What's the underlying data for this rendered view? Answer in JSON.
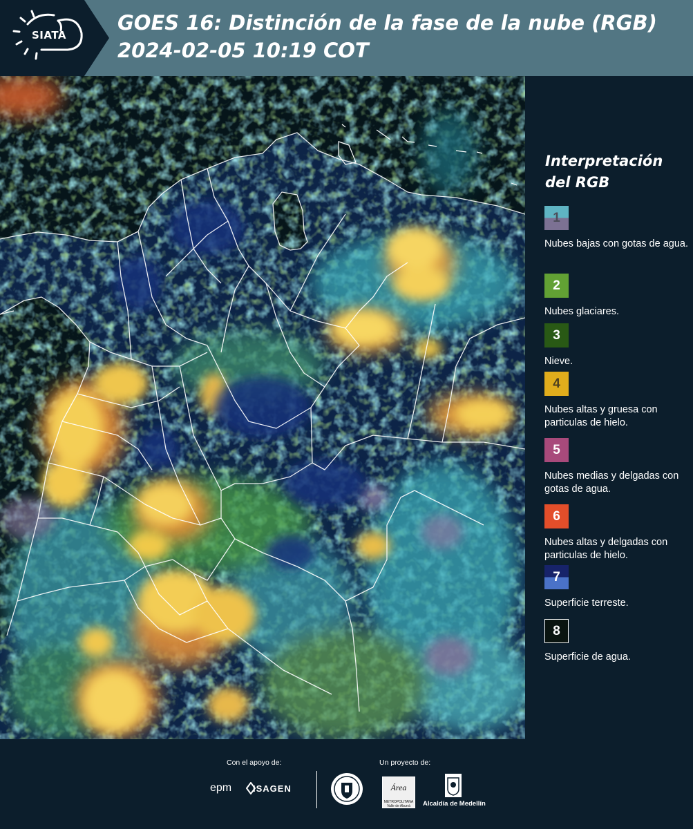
{
  "header": {
    "logo_text": "SIATA",
    "title_line1": "GOES 16: Distinción de la fase de la nube (RGB)",
    "title_line2": "2024-02-05 10:19 COT"
  },
  "legend": {
    "title_line1": "Interpretación",
    "title_line2": "del RGB",
    "items": [
      {
        "num": "1",
        "label": "Nubes bajas con gotas de agua.",
        "color_top": "#5fb4c3",
        "color_bottom": "#7c7193",
        "text_color": "#4d4d5a"
      },
      {
        "num": "2",
        "label": "Nubes glaciares.",
        "color_top": "#62a134",
        "color_bottom": "#62a134",
        "text_color": "#ffffff"
      },
      {
        "num": "3",
        "label": "Nieve.",
        "color_top": "#295915",
        "color_bottom": "#295915",
        "text_color": "#ffffff"
      },
      {
        "num": "4",
        "label": "Nubes altas y gruesa con particulas de hielo.",
        "color_top": "#e1ad1c",
        "color_bottom": "#e1ad1c",
        "text_color": "#4d4020"
      },
      {
        "num": "5",
        "label": "Nubes medias y delgadas con gotas de agua.",
        "color_top": "#a84a7b",
        "color_bottom": "#a84a7b",
        "text_color": "#ffffff"
      },
      {
        "num": "6",
        "label": "Nubes altas y delgadas con particulas de hielo.",
        "color_top": "#e34e2a",
        "color_bottom": "#e34e2a",
        "text_color": "#ffffff"
      },
      {
        "num": "7",
        "label": "Superficie terreste.",
        "color_top": "#17236a",
        "color_bottom": "#4a72c8",
        "text_color": "#ffffff"
      },
      {
        "num": "8",
        "label": "Superficie de agua.",
        "color_top": "#0a1410",
        "color_bottom": "#0a1410",
        "text_color": "#ffffff"
      }
    ]
  },
  "footer": {
    "support_caption": "Con el apoyo de:",
    "project_caption": "Un proyecto de:",
    "epm": "epm",
    "isagen": "ISAGEN",
    "area_logo": "Área",
    "area_sub": "METROPOLITANA Valle de Aburrá",
    "alcaldia": "Alcaldía de Medellín"
  },
  "colors": {
    "header_bg": "#527683",
    "panel_bg": "#0c1e2c",
    "land_blue": "#0d2447",
    "ocean": "#06151a",
    "cloud_yellow": "#f0c94a",
    "cloud_cyan": "#5fc6cf",
    "cloud_green": "#5aa83a"
  }
}
